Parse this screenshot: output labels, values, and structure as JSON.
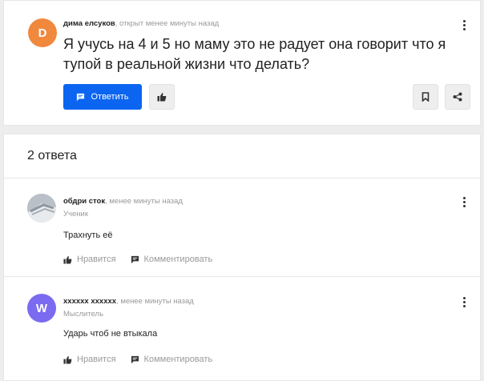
{
  "question": {
    "avatar_letter": "D",
    "author": "дима елсуков",
    "meta": ", открыт менее минуты назад",
    "title": "Я учусь на 4 и 5 но маму это не радует она говорит что я тупой в реальной жизни что делать?",
    "reply_label": "Ответить"
  },
  "answers_header": {
    "count_label": "2 ответа"
  },
  "answers": [
    {
      "author": "обдри сток",
      "meta": ", менее минуты назад",
      "rank": "Ученик",
      "text": "Трахнуть её",
      "like_label": "Нравится",
      "comment_label": "Комментировать"
    },
    {
      "avatar_letter": "W",
      "author": "хххххх хххххх",
      "meta": ", менее минуты назад",
      "rank": "Мыслитель",
      "text": "Ударь чтоб не втыкала",
      "like_label": "Нравится",
      "comment_label": "Комментировать"
    }
  ],
  "colors": {
    "accent": "#0b65f1",
    "question_avatar": "#f0883e",
    "answer2_avatar": "#7a6bf1"
  },
  "icons": [
    "more-vertical-icon",
    "comment-icon",
    "thumbs-up-icon",
    "bookmark-icon",
    "share-icon"
  ]
}
